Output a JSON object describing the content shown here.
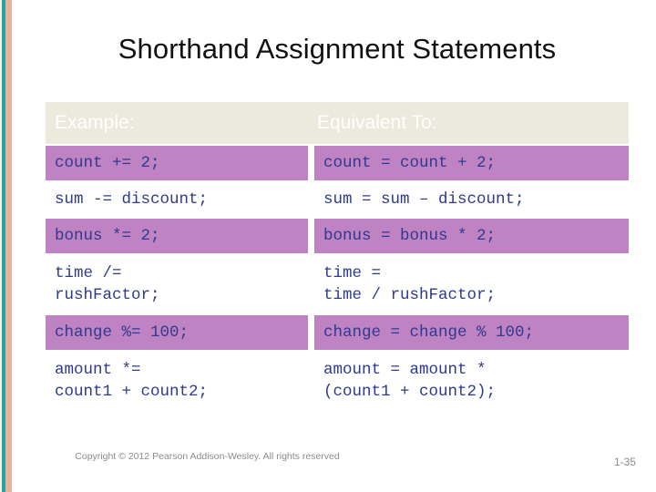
{
  "slide": {
    "title": "Shorthand Assignment Statements",
    "background_color": "#ffffff"
  },
  "decor": {
    "stripe_pale_color": "#f3f0ea",
    "stripe_teal_color": "#2aa39a",
    "stripe_salmon_color": "#e4b49e"
  },
  "table": {
    "header_bg_color": "#ece9dd",
    "header_text_color": "#ffffff",
    "row_accent_color": "#bf82c2",
    "row_alt_color": "#ffffff",
    "code_text_color": "#2e3a8f",
    "headers": {
      "example": "Example:",
      "equivalent": "Equivalent To:"
    },
    "rows": [
      {
        "example": "count += 2;",
        "equivalent": "count = count + 2;",
        "fill": "purple",
        "tall": false
      },
      {
        "example": "sum -= discount;",
        "equivalent": "sum = sum – discount;",
        "fill": "white",
        "tall": false
      },
      {
        "example": "bonus *= 2;",
        "equivalent": "bonus = bonus * 2;",
        "fill": "purple",
        "tall": false
      },
      {
        "example": "time /=\nrushFactor;",
        "equivalent": "time =\ntime / rushFactor;",
        "fill": "white",
        "tall": true
      },
      {
        "example": "change %= 100;",
        "equivalent": "change = change % 100;",
        "fill": "purple",
        "tall": false
      },
      {
        "example": "amount *=\ncount1 + count2;",
        "equivalent": "amount = amount *\n(count1 + count2);",
        "fill": "white",
        "tall": true
      }
    ]
  },
  "footer": {
    "copyright": "Copyright © 2012 Pearson Addison-Wesley. All rights reserved",
    "slide_number": "1-35",
    "text_color": "#8c8c8c"
  }
}
